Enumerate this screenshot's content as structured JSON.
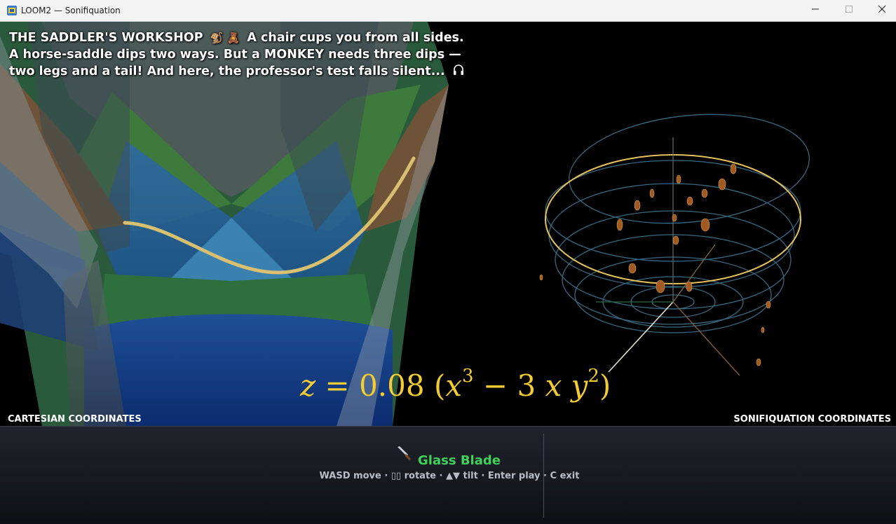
{
  "window": {
    "title": "LOOM2 — Sonifiquation"
  },
  "caption": {
    "line1": "THE SADDLER'S WORKSHOP",
    "emoji": "🐒 🧸",
    "line1_rest": "A chair cups you from all sides.",
    "line2": "A horse-saddle dips two ways. But a MONKEY needs three dips —",
    "line3": "two legs and a tail! And here, the professor's test falls silent...",
    "headphones_icon": "headphones-icon"
  },
  "equation": {
    "lhs": "z",
    "eq": "=",
    "coef": "0.08",
    "x": "x",
    "exp1": "3",
    "minus": "−",
    "three": "3",
    "y": "y",
    "exp2": "2"
  },
  "labels": {
    "left": "CARTESIAN COORDINATES",
    "right": "SONIFIQUATION COORDINATES"
  },
  "hud": {
    "tool_icon": "knife-icon",
    "tool_name": "Glass Blade",
    "hint": "WASD move · ▯▯ rotate · ▲▼ tilt · Enter play · C exit"
  },
  "colors": {
    "equation": "#f2cc30",
    "tool": "#3fd15a",
    "curve": "#d8c070",
    "ring_highlight": "#e6c25a"
  }
}
